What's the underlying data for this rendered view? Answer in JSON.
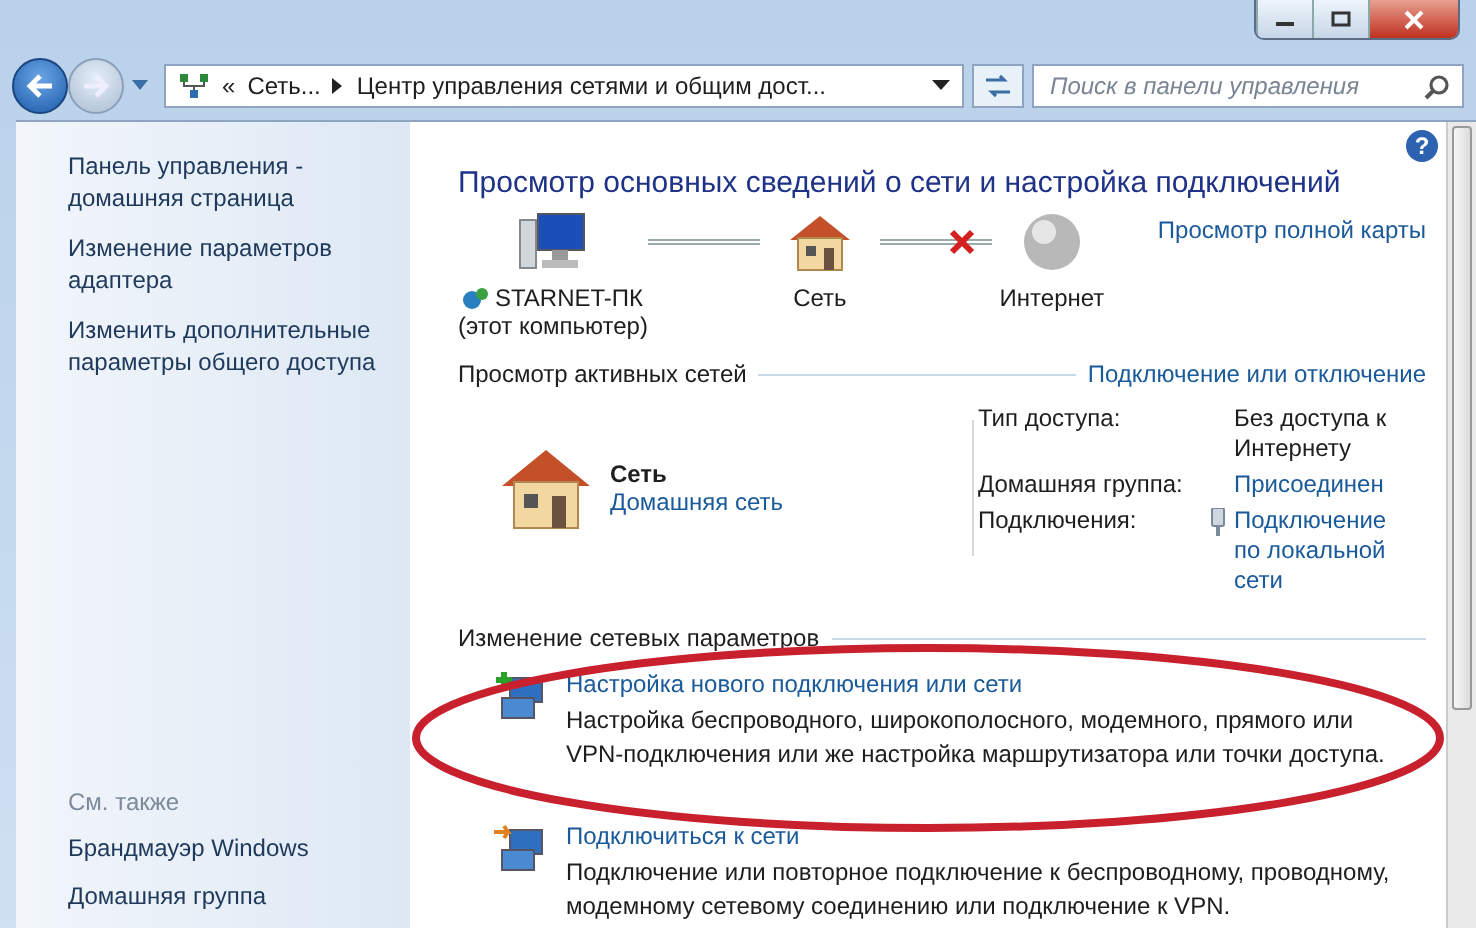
{
  "address_bar": {
    "breadcrumbs": [
      "Сеть...",
      "Центр управления сетями и общим дост..."
    ],
    "overflow": "«"
  },
  "search": {
    "placeholder": "Поиск в панели управления"
  },
  "help_button": "?",
  "sidebar": {
    "links": [
      "Панель управления - домашняя страница",
      "Изменение параметров адаптера",
      "Изменить дополнительные параметры общего доступа"
    ],
    "see_also": {
      "title": "См. также",
      "links": [
        "Брандмауэр Windows",
        "Домашняя группа"
      ]
    }
  },
  "main": {
    "title": "Просмотр основных сведений о сети и настройка подключений",
    "map": {
      "full_map_link": "Просмотр полной карты",
      "nodes": [
        {
          "kind": "computer",
          "label": "STARNET-ПК",
          "sublabel": "(этот компьютер)"
        },
        {
          "kind": "network",
          "label": "Сеть"
        },
        {
          "kind": "internet",
          "label": "Интернет"
        }
      ],
      "links": [
        {
          "connected": true
        },
        {
          "connected": false
        }
      ]
    },
    "active_networks": {
      "heading": "Просмотр активных сетей",
      "action_link": "Подключение или отключение",
      "network": {
        "name": "Сеть",
        "type_link": "Домашняя сеть"
      },
      "properties": [
        {
          "label": "Тип доступа:",
          "value": "Без доступа к Интернету",
          "kind": "text"
        },
        {
          "label": "Домашняя группа:",
          "value": "Присоединен",
          "kind": "link"
        },
        {
          "label": "Подключения:",
          "value": "Подключение по локальной сети",
          "kind": "connection"
        }
      ]
    },
    "changes": {
      "heading": "Изменение сетевых параметров",
      "tasks": [
        {
          "kind": "new",
          "title": "Настройка нового подключения или сети",
          "description": "Настройка беспроводного, широкополосного, модемного, прямого или VPN-подключения или же настройка маршрутизатора или точки доступа."
        },
        {
          "kind": "connect",
          "title": "Подключиться к сети",
          "description": "Подключение или повторное подключение к беспроводному, проводному, модемному сетевому соединению или подключение к VPN."
        }
      ]
    }
  }
}
